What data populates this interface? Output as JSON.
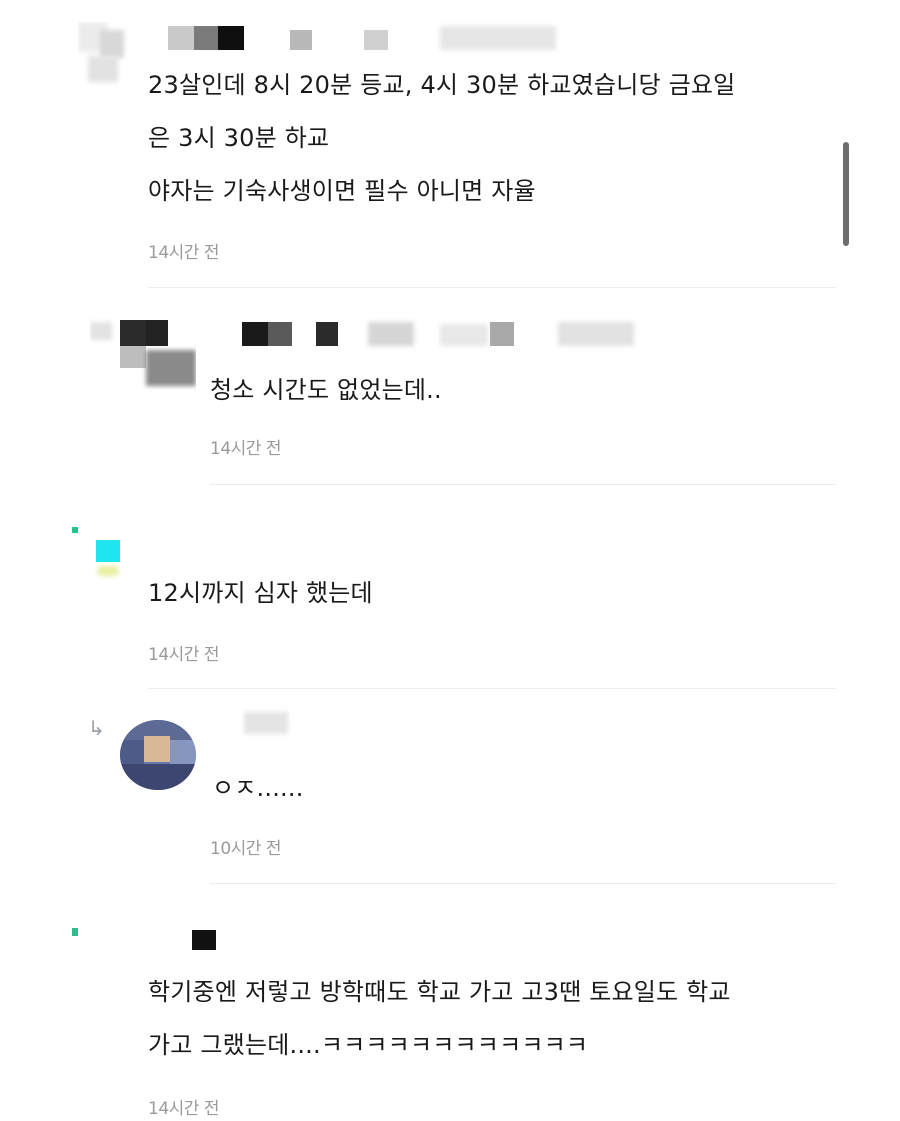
{
  "comments": [
    {
      "lines": [
        "23살인데 8시 20분 등교, 4시 30분 하교였습니당 금요일",
        "은 3시 30분 하교",
        "야자는 기숙사생이면 필수 아니면 자율"
      ],
      "time": "14시간 전"
    },
    {
      "lines": [
        "청소 시간도 없었는데.."
      ],
      "time": "14시간 전"
    },
    {
      "lines": [
        "12시까지 심자 했는데"
      ],
      "time": "14시간 전"
    },
    {
      "lines": [
        "ㅇㅈ......"
      ],
      "time": "10시간 전"
    },
    {
      "lines": [
        "학기중엔 저렇고 방학때도 학교 가고 고3땐 토요일도 학교",
        "가고 그랬는데....ㅋㅋㅋㅋㅋㅋㅋㅋㅋㅋㅋㅋ"
      ],
      "time": "14시간 전"
    }
  ],
  "icons": {
    "reply": "reply-arrow-icon",
    "avatar": "avatar-icon"
  }
}
